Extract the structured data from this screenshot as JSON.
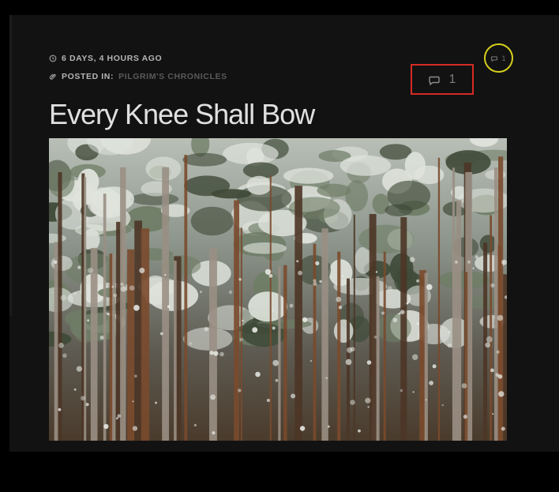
{
  "post": {
    "date_label": "6 DAYS, 4 HOURS AGO",
    "posted_in_label": "POSTED IN:",
    "category": "PILGRIM'S CHRONICLES",
    "title": "Every Knee Shall Bow",
    "comment_count": "1",
    "comment_count_small": "1"
  },
  "icons": {
    "date": "clock-icon",
    "category": "tag-icon",
    "comments": "speech-bubble-icon"
  },
  "colors": {
    "background": "#121212",
    "text": "#e0e0e0",
    "muted": "#5a5a5a",
    "highlight_box": "#d62b24",
    "highlight_circle": "#d6cf1c"
  },
  "image": {
    "subject": "snow-covered pine forest"
  }
}
